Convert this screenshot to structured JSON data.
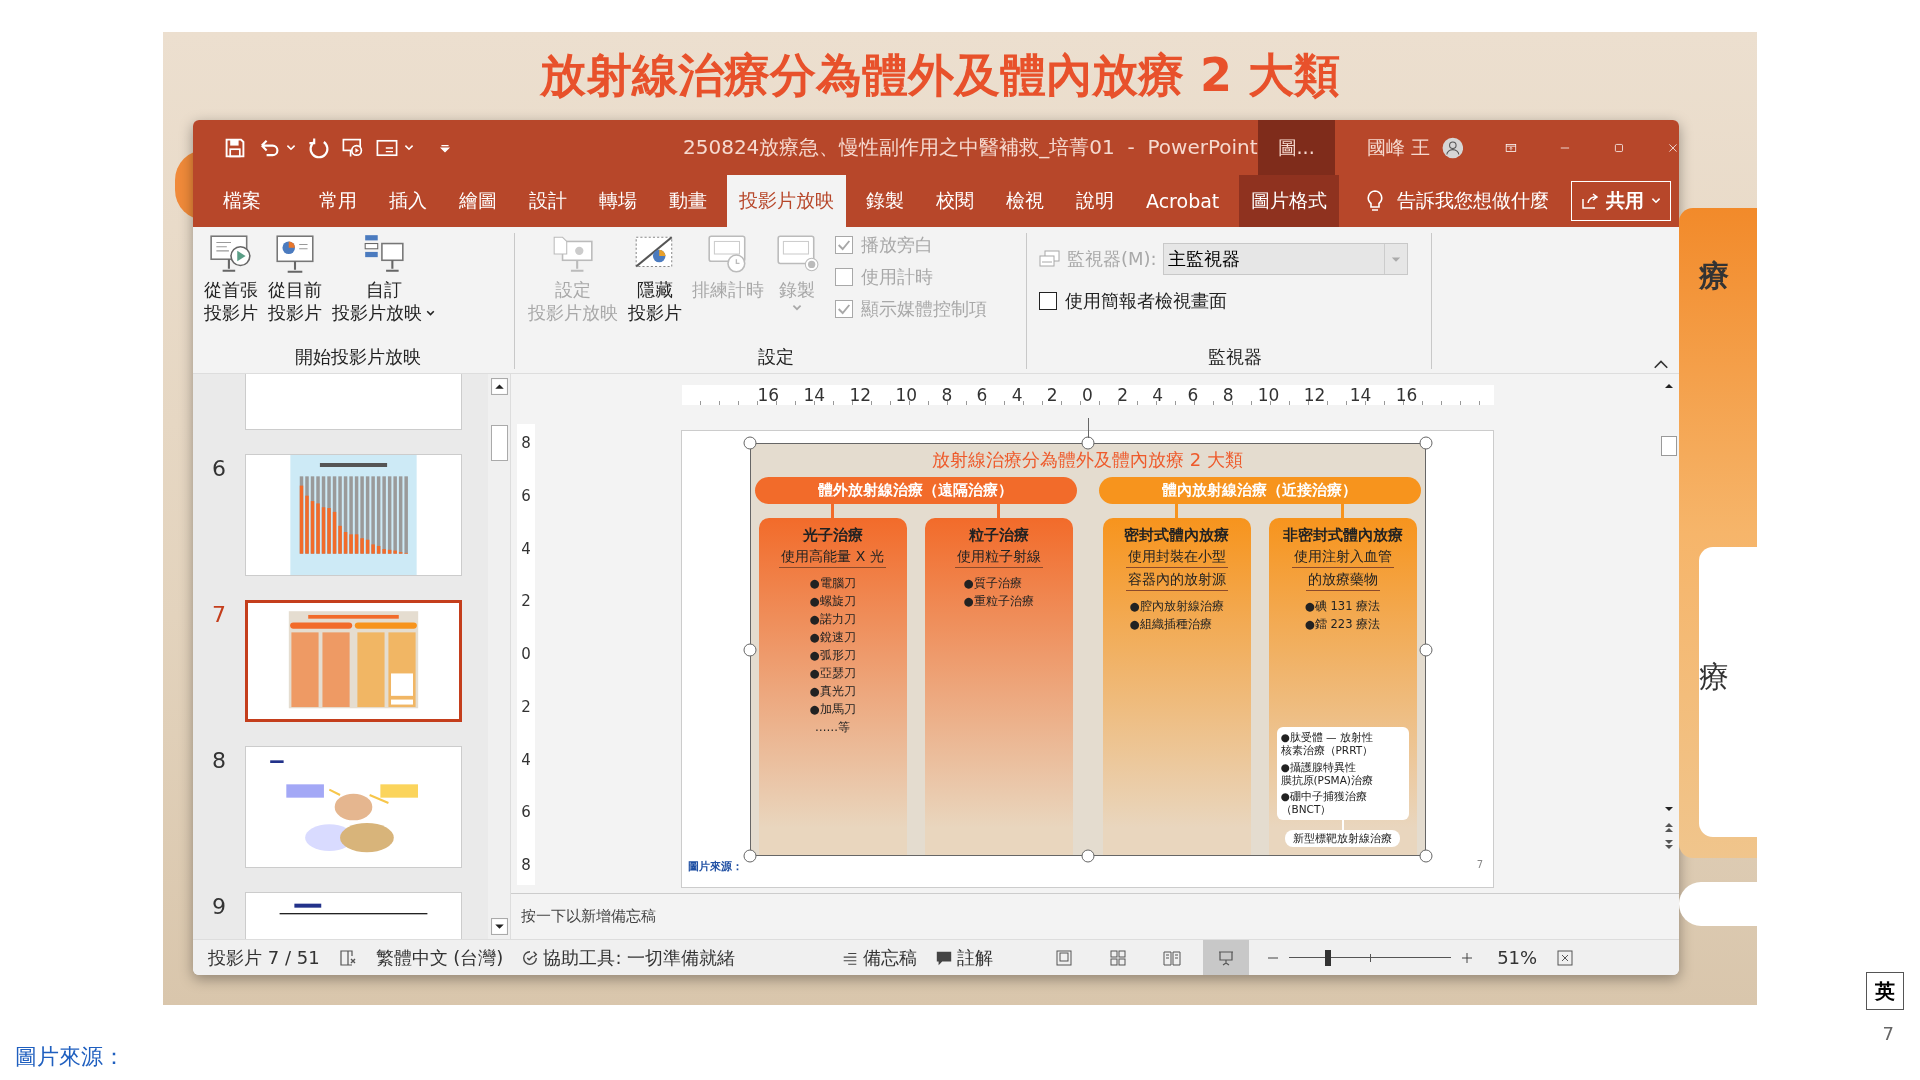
{
  "slide_title": "放射線治療分為體外及體內放療 2 大類",
  "background_fragments": [
    "療",
    "療"
  ],
  "window": {
    "title": "250824放療急、慢性副作用之中醫補救_培菁01  -  PowerPoint",
    "context_label": "圖...",
    "user": "國峰 王"
  },
  "tabs": [
    {
      "label": "檔案",
      "selected": false,
      "kind": "plain"
    },
    {
      "label": "常用",
      "selected": false,
      "kind": "plain"
    },
    {
      "label": "插入",
      "selected": false,
      "kind": "plain"
    },
    {
      "label": "繪圖",
      "selected": false,
      "kind": "plain"
    },
    {
      "label": "設計",
      "selected": false,
      "kind": "plain"
    },
    {
      "label": "轉場",
      "selected": false,
      "kind": "plain"
    },
    {
      "label": "動畫",
      "selected": false,
      "kind": "plain"
    },
    {
      "label": "投影片放映",
      "selected": true,
      "kind": "plain"
    },
    {
      "label": "錄製",
      "selected": false,
      "kind": "plain"
    },
    {
      "label": "校閱",
      "selected": false,
      "kind": "plain"
    },
    {
      "label": "檢視",
      "selected": false,
      "kind": "plain"
    },
    {
      "label": "說明",
      "selected": false,
      "kind": "plain"
    },
    {
      "label": "Acrobat",
      "selected": false,
      "kind": "plain"
    },
    {
      "label": "圖片格式",
      "selected": false,
      "kind": "contextual"
    }
  ],
  "tell_me": "告訴我您想做什麼",
  "share_button": "共用",
  "ribbon_groups": [
    {
      "label": "開始投影片放映",
      "items": [
        {
          "kind": "big",
          "lines": [
            "從首張",
            "投影片"
          ],
          "disabled": false,
          "dropdown": false
        },
        {
          "kind": "big",
          "lines": [
            "從目前",
            "投影片"
          ],
          "disabled": false,
          "dropdown": false
        },
        {
          "kind": "big",
          "lines": [
            "自訂",
            "投影片放映"
          ],
          "disabled": false,
          "dropdown": true
        }
      ]
    },
    {
      "label": "設定",
      "items": [
        {
          "kind": "big",
          "lines": [
            "設定",
            "投影片放映"
          ],
          "disabled": true,
          "dropdown": false
        },
        {
          "kind": "big",
          "lines": [
            "隱藏",
            "投影片"
          ],
          "disabled": false,
          "dropdown": false
        },
        {
          "kind": "big",
          "lines": [
            "排練計時"
          ],
          "disabled": true,
          "dropdown": false
        },
        {
          "kind": "big",
          "lines": [
            "錄製"
          ],
          "disabled": true,
          "dropdown": true
        },
        {
          "kind": "checks",
          "checks": [
            {
              "label": "播放旁白",
              "checked": true,
              "disabled": true
            },
            {
              "label": "使用計時",
              "checked": false,
              "disabled": true
            },
            {
              "label": "顯示媒體控制項",
              "checked": true,
              "disabled": true
            }
          ]
        }
      ]
    },
    {
      "label": "監視器",
      "items": [
        {
          "kind": "monitor",
          "label": "監視器(M):",
          "value": "主監視器",
          "disabled": true,
          "checkbox": {
            "label": "使用簡報者檢視畫面",
            "checked": false,
            "disabled": false
          }
        }
      ]
    }
  ],
  "thumbnails": [
    {
      "selected": false
    },
    {
      "number": "6",
      "selected": false
    },
    {
      "number": "7",
      "selected": true
    },
    {
      "number": "8",
      "selected": false
    },
    {
      "number": "9",
      "selected": false
    }
  ],
  "ruler_h": [
    "16",
    "14",
    "12",
    "10",
    "8",
    "6",
    "4",
    "2",
    "0",
    "2",
    "4",
    "6",
    "8",
    "10",
    "12",
    "14",
    "16"
  ],
  "ruler_v": [
    "8",
    "6",
    "4",
    "2",
    "0",
    "2",
    "4",
    "6",
    "8"
  ],
  "diagram": {
    "title": "放射線治療分為體外及體內放療 2 大類",
    "groups": [
      {
        "heading": "體外放射線治療（遠隔治療）",
        "color": "#f26b2a",
        "cards": [
          {
            "title": "光子治療",
            "subtitle_lines": [
              "使用高能量 X 光"
            ],
            "items": [
              "●電腦刀",
              "●螺旋刀",
              "●諾力刀",
              "●銳速刀",
              "●弧形刀",
              "●亞瑟刀",
              "●真光刀",
              "●加馬刀"
            ],
            "footer": "……等"
          },
          {
            "title": "粒子治療",
            "subtitle_lines": [
              "使用粒子射線"
            ],
            "items": [
              "●質子治療",
              "●重粒子治療"
            ]
          }
        ]
      },
      {
        "heading": "體內放射線治療（近接治療）",
        "color": "#f7941d",
        "cards": [
          {
            "title": "密封式體內放療",
            "subtitle_lines": [
              "使用封裝在小型",
              "容器內的放射源"
            ],
            "items": [
              "●腔內放射線治療",
              "●組織插種治療"
            ]
          },
          {
            "title": "非密封式體內放療",
            "subtitle_lines": [
              "使用注射入血管",
              "的放療藥物"
            ],
            "items": [
              "●碘 131 療法",
              "●鐳 223 療法"
            ],
            "note_box": [
              [
                "●肽受體 — 放射性",
                "核素治療（PRRT）"
              ],
              [
                "●攝護腺特異性",
                "膜抗原(PSMA)治療"
              ],
              [
                "●硼中子捕獲治療",
                "（BNCT）"
              ]
            ],
            "note_label": "新型標靶放射線治療"
          }
        ]
      }
    ]
  },
  "slide_source": "圖片來源：",
  "slide_number": "7",
  "notes_placeholder": "按一下以新增備忘稿",
  "status_bar": {
    "slide_counter": "投影片 7 / 51",
    "language": "繁體中文 (台灣)",
    "accessibility": "協助工具: 一切準備就緒",
    "notes_button": "備忘稿",
    "comments_button": "註解",
    "views": [
      {
        "selected": false
      },
      {
        "selected": false
      },
      {
        "selected": false
      },
      {
        "selected": true
      }
    ],
    "zoom": {
      "level": 0.24,
      "reading": "51%"
    }
  },
  "page_source": "圖片來源：",
  "ime_indicator": "英",
  "page_number": "7"
}
